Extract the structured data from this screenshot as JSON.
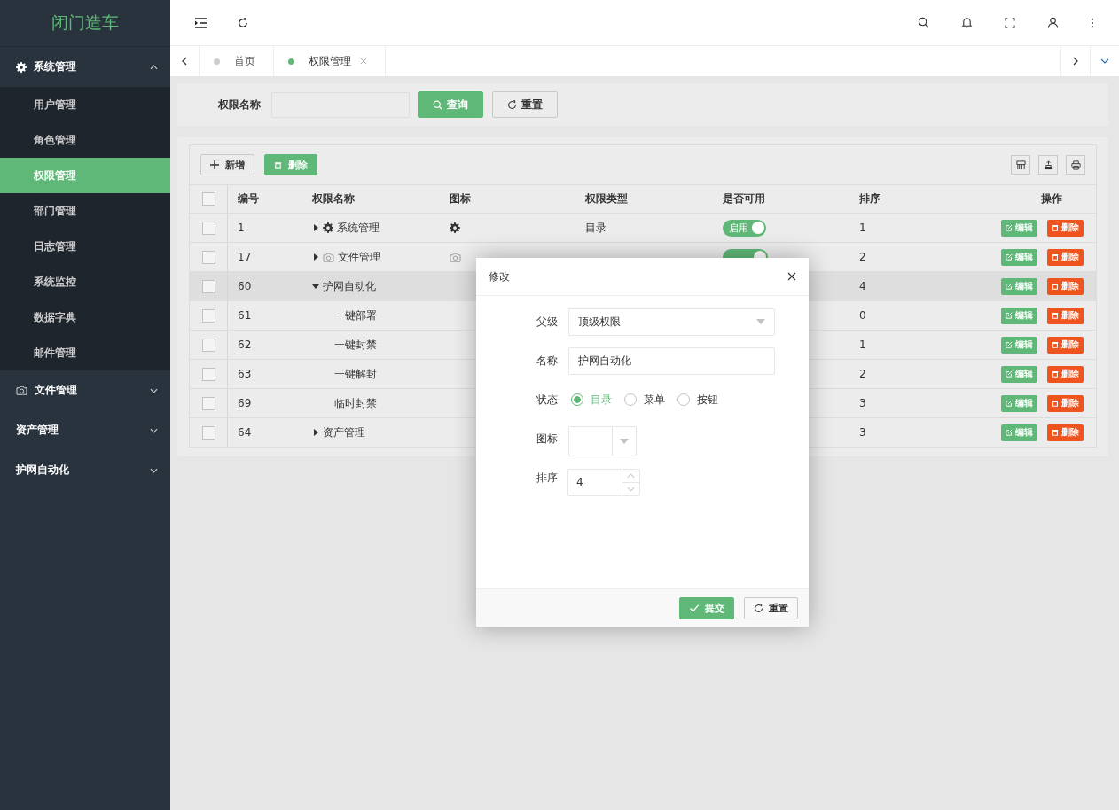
{
  "sidebar": {
    "logo": "闭门造车",
    "menu": [
      {
        "label": "系统管理",
        "expanded": true,
        "children": [
          {
            "label": "用户管理",
            "selected": false
          },
          {
            "label": "角色管理",
            "selected": false
          },
          {
            "label": "权限管理",
            "selected": true
          },
          {
            "label": "部门管理",
            "selected": false
          },
          {
            "label": "日志管理",
            "selected": false
          },
          {
            "label": "系统监控",
            "selected": false
          },
          {
            "label": "数据字典",
            "selected": false
          },
          {
            "label": "邮件管理",
            "selected": false
          }
        ]
      },
      {
        "label": "文件管理",
        "expanded": false
      },
      {
        "label": "资产管理",
        "expanded": false
      },
      {
        "label": "护网自动化",
        "expanded": false
      }
    ]
  },
  "tabs": [
    {
      "label": "首页",
      "selected": false,
      "closable": false
    },
    {
      "label": "权限管理",
      "selected": true,
      "closable": true
    }
  ],
  "search": {
    "label": "权限名称",
    "query_button": "查询",
    "reset_button": "重置"
  },
  "toolbar": {
    "add_button": "新增",
    "delete_button": "删除"
  },
  "table": {
    "all_checked": false,
    "columns": [
      "编号",
      "权限名称",
      "图标",
      "权限类型",
      "是否可用",
      "排序",
      "操作"
    ],
    "rows": [
      {
        "id": "1",
        "name": "系统管理",
        "type": "目录",
        "switch_label": "启用",
        "enabled": true,
        "sort": "1",
        "expanded": false,
        "checked": false,
        "highlighted": false,
        "actions": [
          "编辑",
          "删除"
        ]
      },
      {
        "id": "17",
        "name": "文件管理",
        "enabled": true,
        "sort": "2",
        "expanded": false,
        "checked": false,
        "highlighted": false,
        "actions": [
          "编辑",
          "删除"
        ]
      },
      {
        "id": "60",
        "name": "护网自动化",
        "sort": "4",
        "expanded": true,
        "checked": false,
        "highlighted": true,
        "actions": [
          "编辑",
          "删除"
        ],
        "children": [
          {
            "id": "61",
            "name": "一键部署",
            "sort": "0",
            "checked": false,
            "highlighted": false,
            "actions": [
              "编辑",
              "删除"
            ]
          },
          {
            "id": "62",
            "name": "一键封禁",
            "sort": "1",
            "checked": false,
            "highlighted": false,
            "actions": [
              "编辑",
              "删除"
            ]
          },
          {
            "id": "63",
            "name": "一键解封",
            "sort": "2",
            "checked": false,
            "highlighted": false,
            "actions": [
              "编辑",
              "删除"
            ]
          },
          {
            "id": "69",
            "name": "临时封禁",
            "sort": "3",
            "checked": false,
            "highlighted": false,
            "actions": [
              "编辑",
              "删除"
            ]
          }
        ]
      },
      {
        "id": "64",
        "name": "资产管理",
        "sort": "3",
        "expanded": false,
        "checked": false,
        "highlighted": false,
        "actions": [
          "编辑",
          "删除"
        ]
      }
    ]
  },
  "dialog": {
    "title": "修改",
    "fields": [
      {
        "kind": "select",
        "label": "父级",
        "value": "顶级权限"
      },
      {
        "kind": "text",
        "label": "名称",
        "value": "护网自动化"
      },
      {
        "kind": "radio",
        "label": "状态",
        "options": [
          {
            "label": "目录",
            "selected": true
          },
          {
            "label": "菜单",
            "selected": false
          },
          {
            "label": "按钮",
            "selected": false
          }
        ]
      },
      {
        "kind": "iconselect",
        "label": "图标"
      },
      {
        "kind": "number",
        "label": "排序",
        "value": "4"
      }
    ],
    "submit_button": "提交",
    "reset_button": "重置"
  }
}
